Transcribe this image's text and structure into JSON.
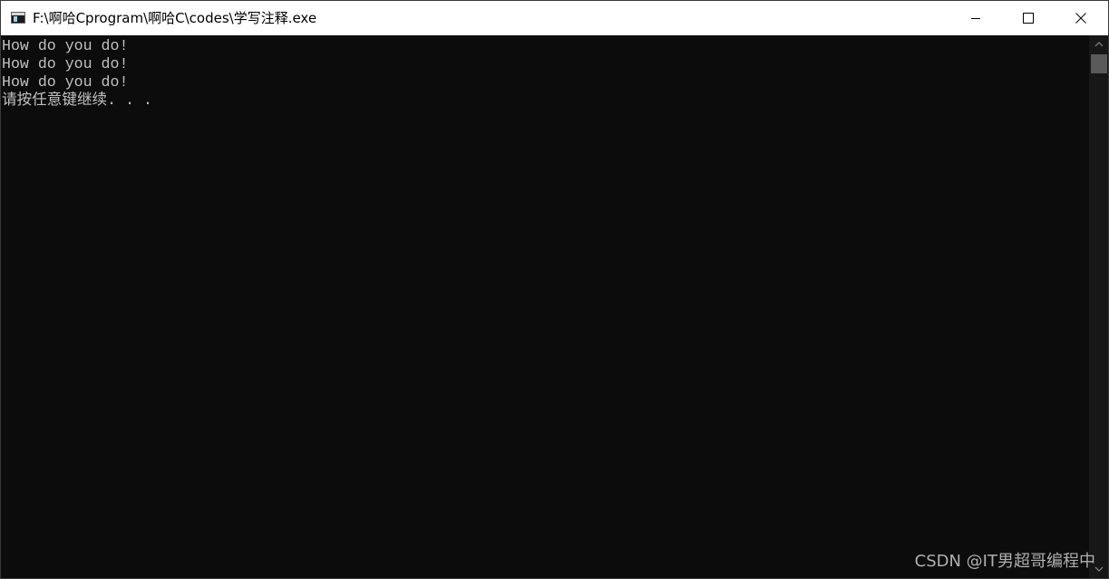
{
  "window": {
    "title": "F:\\啊哈Cprogram\\啊哈C\\codes\\学写注释.exe",
    "app_icon": "console-window-icon",
    "caption_buttons": {
      "minimize_icon": "minimize-icon",
      "maximize_icon": "maximize-icon",
      "close_icon": "close-icon"
    }
  },
  "console": {
    "lines": [
      "How do you do!",
      "How do you do!",
      "How do you do!",
      "请按任意键继续. . ."
    ],
    "background_color": "#0c0c0c",
    "text_color": "#c0c0c0"
  },
  "scrollbar": {
    "up_icon": "chevron-up-icon",
    "down_icon": "chevron-down-icon"
  },
  "watermark": {
    "text": "CSDN @IT男超哥编程中"
  }
}
